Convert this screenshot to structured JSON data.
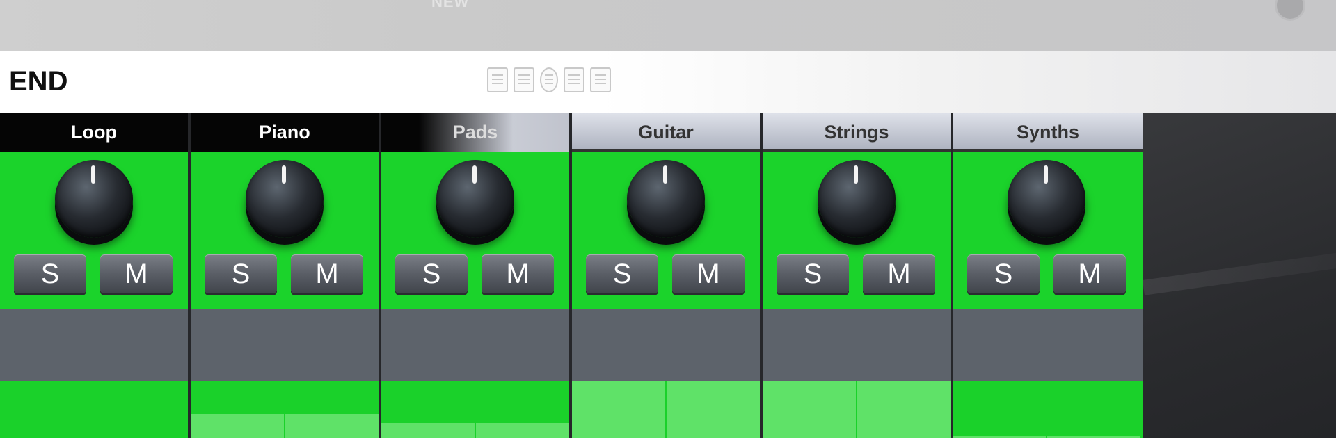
{
  "top_strip": {
    "faded_label": "NEW"
  },
  "header": {
    "title": "END"
  },
  "mixer": {
    "channels": [
      {
        "title": "Loop",
        "solo": "S",
        "mute": "M",
        "pads": [
          0.0,
          0.0
        ]
      },
      {
        "title": "Piano",
        "solo": "S",
        "mute": "M",
        "pads": [
          0.42,
          0.42
        ]
      },
      {
        "title": "Pads",
        "solo": "S",
        "mute": "M",
        "pads": [
          0.25,
          0.25
        ]
      },
      {
        "title": "Guitar",
        "solo": "S",
        "mute": "M",
        "pads": [
          1.0,
          1.0
        ]
      },
      {
        "title": "Strings",
        "solo": "S",
        "mute": "M",
        "pads": [
          1.0,
          1.0
        ]
      },
      {
        "title": "Synths",
        "solo": "S",
        "mute": "M",
        "pads": [
          0.04,
          0.04
        ]
      }
    ]
  },
  "colors": {
    "channel_green": "#1ad12a",
    "pad_light": "#5fe268",
    "gray_band": "#5d636b",
    "title_black": "#050505"
  },
  "icons": [
    "document-icon",
    "document-icon",
    "e-icon",
    "document-icon",
    "share-icon"
  ]
}
